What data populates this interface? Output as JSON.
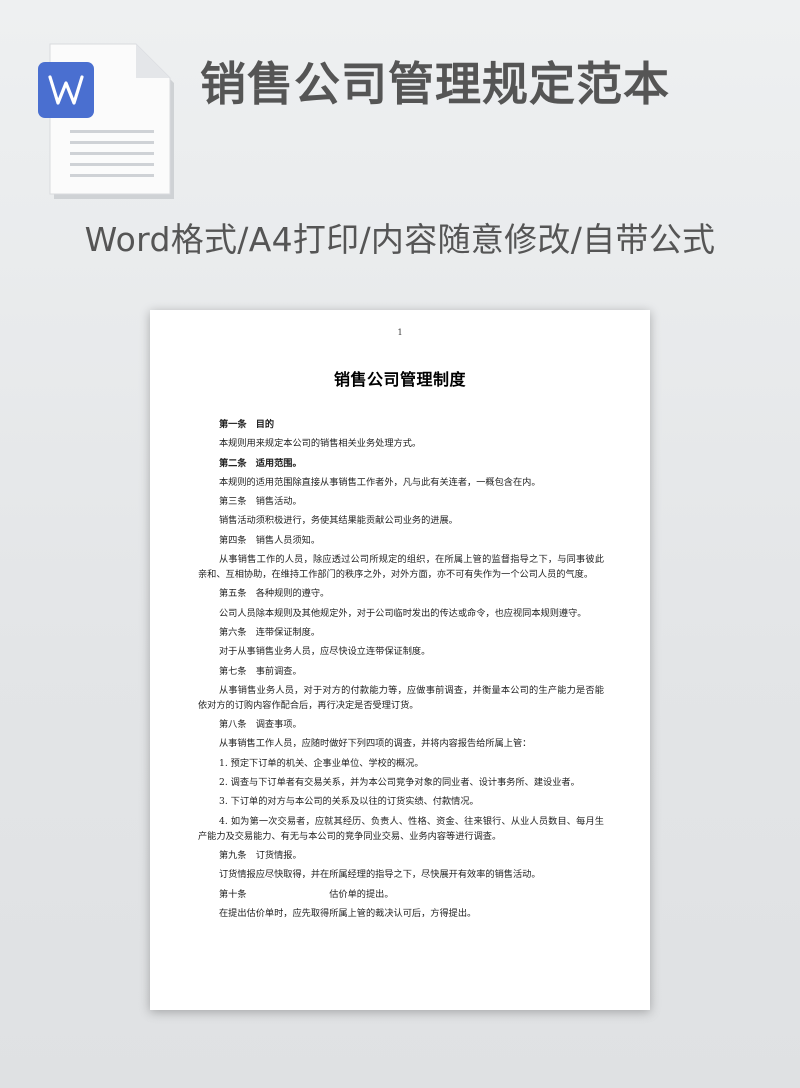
{
  "header": {
    "title": "销售公司管理规定范本",
    "subtitle": "Word格式/A4打印/内容随意修改/自带公式",
    "icon": "word-file-icon",
    "icon_badge_letter": "W",
    "colors": {
      "badge": "#4a6fd0",
      "title_text": "#555555"
    }
  },
  "document": {
    "page_number": "1",
    "title": "销售公司管理制度",
    "paragraphs": [
      {
        "text": "第一条　目的",
        "bold": true
      },
      {
        "text": "本规则用来规定本公司的销售相关业务处理方式。",
        "bold": false
      },
      {
        "text": "第二条　适用范围。",
        "bold": true
      },
      {
        "text": "本规则的适用范围除直接从事销售工作者外，凡与此有关连者，一概包含在内。",
        "bold": false
      },
      {
        "text": "第三条　销售活动。",
        "bold": false
      },
      {
        "text": "销售活动须积极进行，务使其结果能贡献公司业务的进展。",
        "bold": false
      },
      {
        "text": "第四条　销售人员须知。",
        "bold": false
      },
      {
        "text": "从事销售工作的人员，除应透过公司所规定的组织，在所属上管的监督指导之下，与同事彼此亲和、互相协助，在维持工作部门的秩序之外，对外方面，亦不可有失作为一个公司人员的气度。",
        "bold": false
      },
      {
        "text": "第五条　各种规则的遵守。",
        "bold": false
      },
      {
        "text": "公司人员除本规则及其他规定外，对于公司临时发出的传达或命令，也应视同本规则遵守。",
        "bold": false
      },
      {
        "text": "第六条　连带保证制度。",
        "bold": false
      },
      {
        "text": "对于从事销售业务人员，应尽快设立连带保证制度。",
        "bold": false
      },
      {
        "text": "第七条　事前调查。",
        "bold": false
      },
      {
        "text": "从事销售业务人员，对于对方的付款能力等，应做事前调查，并衡量本公司的生产能力是否能依对方的订购内容作配合后，再行决定是否受理订货。",
        "bold": false
      },
      {
        "text": "第八条　调查事项。",
        "bold": false
      },
      {
        "text": "从事销售工作人员，应随时做好下列四项的调查，并将内容报告给所属上管：",
        "bold": false
      },
      {
        "text": "1. 预定下订单的机关、企事业单位、学校的概况。",
        "bold": false
      },
      {
        "text": "2. 调查与下订单者有交易关系，并为本公司竞争对象的同业者、设计事务所、建设业者。",
        "bold": false
      },
      {
        "text": "3. 下订单的对方与本公司的关系及以往的订货实绩、付款情况。",
        "bold": false
      },
      {
        "text": "4. 如为第一次交易者，应就其经历、负责人、性格、资金、往来银行、从业人员数目、每月生产能力及交易能力、有无与本公司的竞争同业交易、业务内容等进行调查。",
        "bold": false
      },
      {
        "text": "第九条　订货情报。",
        "bold": false
      },
      {
        "text": "订货情报应尽快取得，并在所属经理的指导之下，尽快展开有效率的销售活动。",
        "bold": false
      },
      {
        "text": "第十条　　　　　　　　　估价单的提出。",
        "bold": false
      },
      {
        "text": "在提出估价单时，应先取得所属上管的裁决认可后，方得提出。",
        "bold": false
      }
    ]
  }
}
